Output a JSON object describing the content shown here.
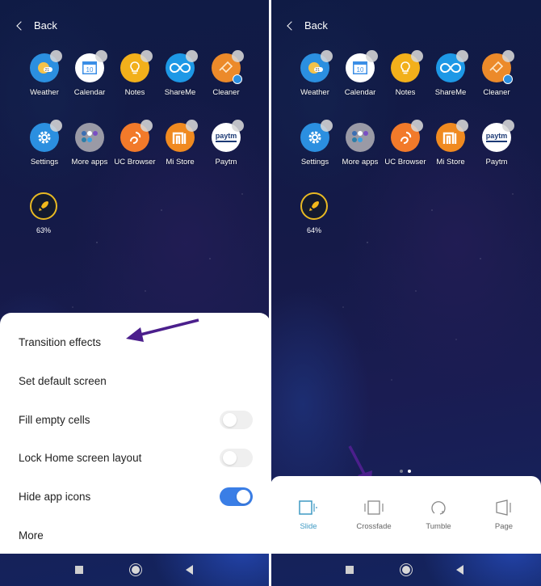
{
  "back_label": "Back",
  "apps_row1": [
    {
      "name": "Weather",
      "icon": "weather-icon",
      "color": "#2b8fe0"
    },
    {
      "name": "Calendar",
      "icon": "calendar-icon",
      "color": "#ffffff"
    },
    {
      "name": "Notes",
      "icon": "lightbulb-icon",
      "color": "#f2b01b"
    },
    {
      "name": "ShareMe",
      "icon": "infinity-icon",
      "color": "#1d98e6"
    },
    {
      "name": "Cleaner",
      "icon": "broom-icon",
      "color": "#ec8a2a"
    }
  ],
  "apps_row2": [
    {
      "name": "Settings",
      "icon": "gear-icon",
      "color": "#2b8fe0"
    },
    {
      "name": "More apps",
      "icon": "folder-icon",
      "color": "#9a9aa6"
    },
    {
      "name": "UC Browser",
      "icon": "squirrel-icon",
      "color": "#f27a2a"
    },
    {
      "name": "Mi Store",
      "icon": "mi-icon",
      "color": "#f08a20"
    },
    {
      "name": "Paytm",
      "icon": "paytm-icon",
      "color": "#ffffff"
    }
  ],
  "calendar_day": "10",
  "weather_temp": "21",
  "paytm_text": "Paytm",
  "left_panel": {
    "boost_percent": "63%",
    "menu": [
      {
        "label": "Transition effects"
      },
      {
        "label": "Set default screen"
      },
      {
        "label": "Fill empty cells",
        "toggle": false
      },
      {
        "label": "Lock Home screen layout",
        "toggle": false
      },
      {
        "label": "Hide app icons",
        "toggle": true
      },
      {
        "label": "More"
      }
    ]
  },
  "right_panel": {
    "boost_percent": "64%",
    "page_indicator": {
      "count": 2,
      "active": 2
    },
    "effects": [
      {
        "label": "Slide",
        "active": true
      },
      {
        "label": "Crossfade",
        "active": false
      },
      {
        "label": "Tumble",
        "active": false
      },
      {
        "label": "Page",
        "active": false
      }
    ]
  },
  "colors": {
    "accent": "#3a7ee6",
    "annotation_arrow": "#4b1f8c",
    "effect_active": "#3f9ac4"
  }
}
